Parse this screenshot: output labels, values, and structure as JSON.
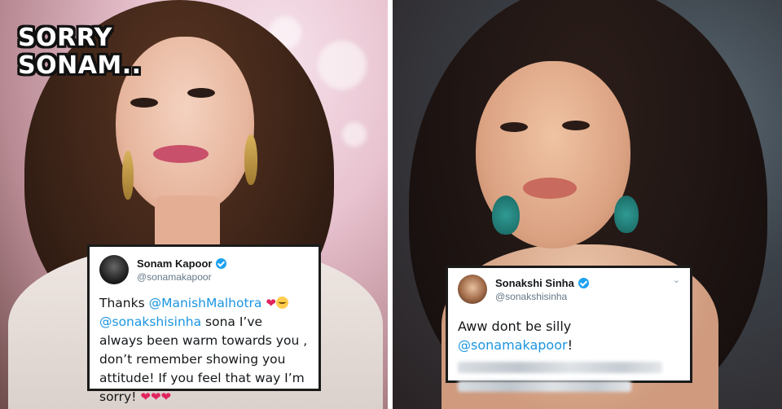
{
  "caption": {
    "line1": "SORRY",
    "line2": "SONAM.."
  },
  "tweet_left": {
    "display_name": "Sonam Kapoor",
    "handle": "@sonamakapoor",
    "verified": true,
    "body_intro": "Thanks ",
    "mention_1": "@ManishMalhotra",
    "mention_2": "@sonakshisinha",
    "body_main": " sona I’ve always been warm towards you , don’t remember showing you attitude! If you feel that way I’m sorry! ",
    "heart": "❤"
  },
  "tweet_right": {
    "display_name": "Sonakshi Sinha",
    "handle": "@sonakshisinha",
    "verified": true,
    "chevron": "⌄",
    "body_intro": "Aww dont be silly ",
    "mention_1": "@sonamakapoor",
    "body_end": "!"
  },
  "colors": {
    "mention": "#1b95e0",
    "verified": "#1da1f2",
    "heart": "#e0245e"
  }
}
